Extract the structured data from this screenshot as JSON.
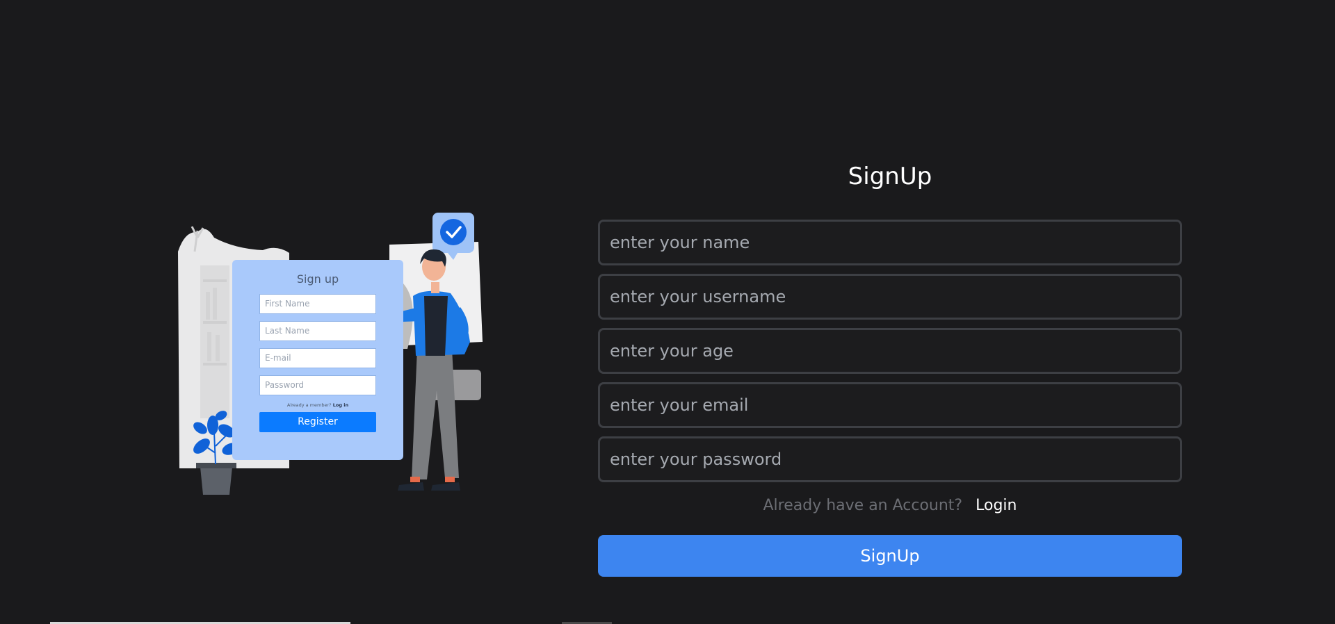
{
  "illustration": {
    "title": "Sign up",
    "fields": [
      "First Name",
      "Last Name",
      "E-mail",
      "Password"
    ],
    "member_text": "Already a member?",
    "member_link": "Log in",
    "register_label": "Register"
  },
  "form": {
    "title": "SignUp",
    "name_placeholder": "enter your name",
    "username_placeholder": "enter your username",
    "age_placeholder": "enter your age",
    "email_placeholder": "enter your email",
    "password_placeholder": "enter your password",
    "account_text": "Already have an Account?",
    "login_label": "Login",
    "submit_label": "SignUp"
  },
  "colors": {
    "background": "#1a1a1c",
    "accent": "#3d85f0",
    "field_border": "#3d3f44",
    "illustration_card": "#a9c9fb",
    "illustration_button": "#0b7bff"
  },
  "icons": [
    "checkmark-icon"
  ]
}
